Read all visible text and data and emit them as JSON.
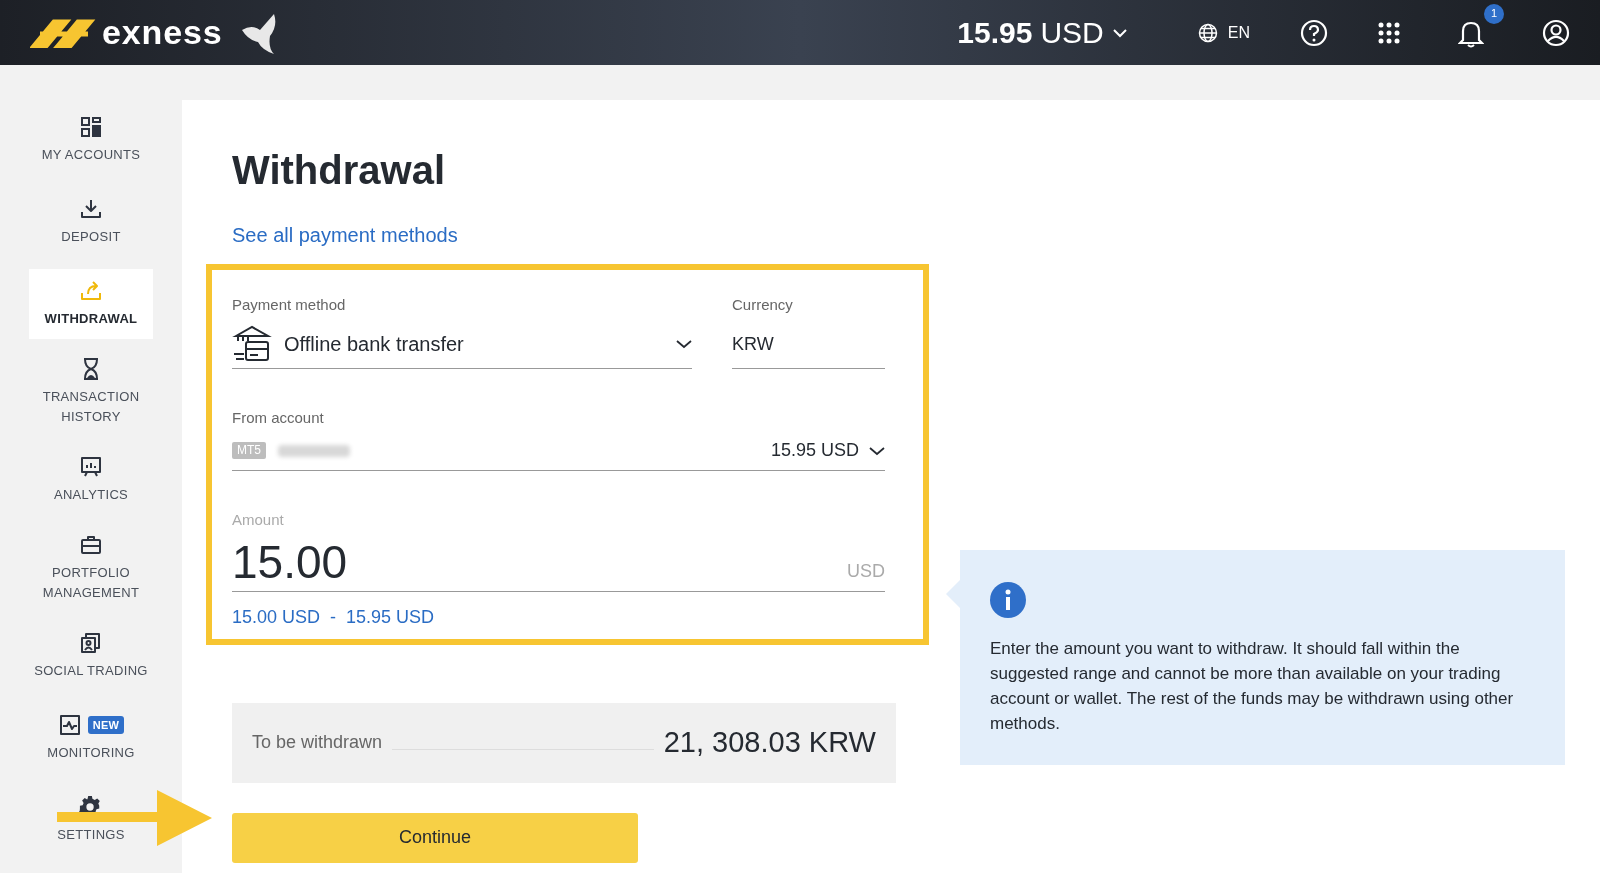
{
  "header": {
    "logo": "exness",
    "balance": {
      "amount": "15.95",
      "currency": "USD"
    },
    "language": "EN",
    "notifications_badge": "1"
  },
  "sidebar": {
    "items": [
      {
        "label": "MY ACCOUNTS",
        "kind": "accounts",
        "selected": false
      },
      {
        "label": "DEPOSIT",
        "kind": "deposit",
        "selected": false
      },
      {
        "label": "WITHDRAWAL",
        "kind": "withdrawal",
        "selected": true
      },
      {
        "label": "TRANSACTION HISTORY",
        "kind": "history",
        "selected": false
      },
      {
        "label": "ANALYTICS",
        "kind": "analytics",
        "selected": false
      },
      {
        "label": "PORTFOLIO MANAGEMENT",
        "kind": "portfolio",
        "selected": false
      },
      {
        "label": "SOCIAL TRADING",
        "kind": "social",
        "selected": false
      },
      {
        "label": "MONITORING",
        "kind": "monitoring",
        "selected": false,
        "badge": "NEW"
      },
      {
        "label": "SETTINGS",
        "kind": "settings",
        "selected": false
      }
    ]
  },
  "page": {
    "title": "Withdrawal",
    "link": "See all payment methods",
    "form": {
      "payment_method": {
        "label": "Payment method",
        "value": "Offline bank transfer"
      },
      "currency": {
        "label": "Currency",
        "value": "KRW"
      },
      "from_account": {
        "label": "From account",
        "platform": "MT5",
        "balance": "15.95 USD"
      },
      "amount": {
        "label": "Amount",
        "value": "15.00",
        "unit": "USD",
        "range_min": "15.00 USD",
        "range_separator": "-",
        "range_max": "15.95 USD"
      }
    },
    "summary": {
      "label": "To be withdrawn",
      "value": "21, 308.03 KRW"
    },
    "continue_button": "Continue",
    "info": "Enter the amount you want to withdraw. It should fall within the suggested range and cannot be more than available on your trading account or wallet. The rest of the funds may be withdrawn using other methods."
  }
}
